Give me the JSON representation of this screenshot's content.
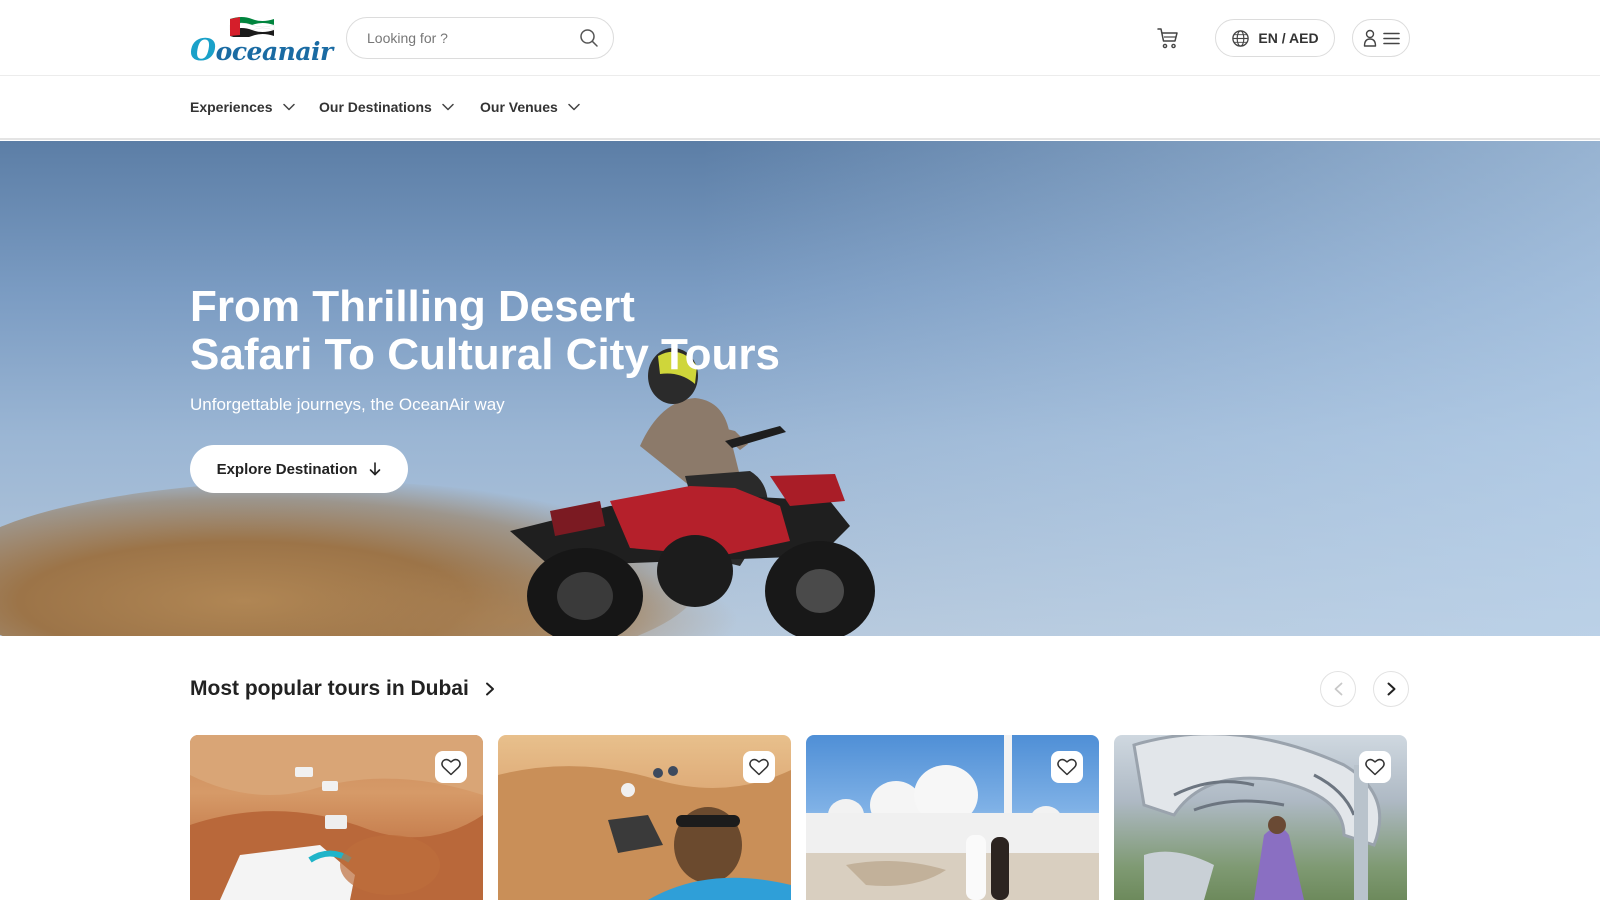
{
  "brand": {
    "name": "oceanair"
  },
  "header": {
    "search_placeholder": "Looking for ?",
    "lang_currency": "EN / AED"
  },
  "nav": {
    "items": [
      {
        "label": "Experiences"
      },
      {
        "label": "Our Destinations"
      },
      {
        "label": "Our Venues"
      }
    ]
  },
  "hero": {
    "title_line1": "From Thrilling Desert",
    "title_line2": "Safari To Cultural City Tours",
    "subtitle": "Unforgettable journeys, the OceanAir way",
    "cta_label": "Explore Destination"
  },
  "popular": {
    "title": "Most popular tours in Dubai"
  },
  "icons": {
    "search": "search-icon",
    "cart": "cart-icon",
    "globe": "globe-icon",
    "user": "user-icon",
    "menu": "hamburger-menu-icon",
    "chevron_down": "chevron-down-icon",
    "arrow_down": "arrow-down-icon",
    "chevron_right": "chevron-right-icon",
    "chevron_left": "chevron-left-icon",
    "heart": "heart-icon"
  },
  "colors": {
    "brand_blue": "#1a6ba3",
    "brand_cyan": "#1aa1c9",
    "text": "#222222",
    "border": "#dcdcdc"
  }
}
